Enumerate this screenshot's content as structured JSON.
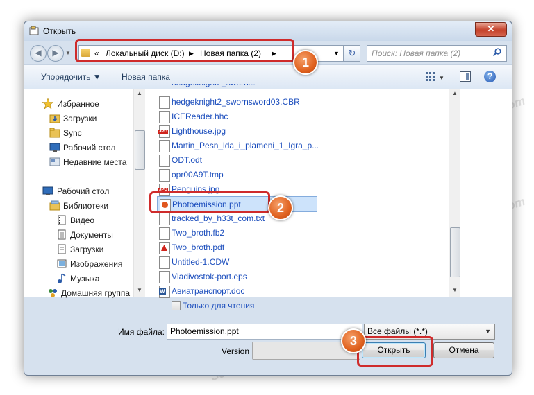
{
  "window": {
    "title": "Открыть",
    "close_label": "✕"
  },
  "navigation": {
    "back_label": "◀",
    "forward_label": "▶",
    "address_prefix": "«",
    "address_segments": [
      "Локальный диск (D:)",
      "Новая папка (2)"
    ],
    "address_dropdown": "▼",
    "refresh_label": "↻",
    "search_placeholder": "Поиск: Новая папка (2)"
  },
  "toolbar": {
    "organize_label": "Упорядочить ▼",
    "new_folder_label": "Новая папка",
    "views_icon": "views-icon",
    "preview_icon": "preview-pane-icon",
    "help_label": "?"
  },
  "nav_pane": {
    "items": [
      {
        "label": "Избранное",
        "icon": "star-icon"
      },
      {
        "label": "Загрузки",
        "icon": "downloads-folder-icon"
      },
      {
        "label": "Sync",
        "icon": "folder-icon"
      },
      {
        "label": "Рабочий стол",
        "icon": "desktop-icon"
      },
      {
        "label": "Недавние места",
        "icon": "recent-places-icon"
      },
      {
        "label": "Рабочий стол",
        "icon": "desktop-icon"
      },
      {
        "label": "Библиотеки",
        "icon": "libraries-icon"
      },
      {
        "label": "Видео",
        "icon": "video-icon"
      },
      {
        "label": "Документы",
        "icon": "documents-icon"
      },
      {
        "label": "Загрузки",
        "icon": "downloads-icon"
      },
      {
        "label": "Изображения",
        "icon": "pictures-icon"
      },
      {
        "label": "Музыка",
        "icon": "music-icon"
      },
      {
        "label": "Домашняя группа",
        "icon": "homegroup-icon"
      }
    ]
  },
  "files": [
    {
      "name": "hedgeknight2_swornsword03.CBR",
      "icon": "document-icon"
    },
    {
      "name": "ICEReader.hhc",
      "icon": "document-icon"
    },
    {
      "name": "Lighthouse.jpg",
      "icon": "jpg-icon"
    },
    {
      "name": "Martin_Pesn_lda_i_plameni_1_Igra_p...",
      "icon": "document-icon"
    },
    {
      "name": "ODT.odt",
      "icon": "document-icon"
    },
    {
      "name": "opr00A9T.tmp",
      "icon": "document-icon"
    },
    {
      "name": "Penguins.jpg",
      "icon": "jpg-icon"
    },
    {
      "name": "Photoemission.ppt",
      "icon": "ppt-icon",
      "selected": true
    },
    {
      "name": "tracked_by_h33t_com.txt",
      "icon": "document-icon"
    },
    {
      "name": "Two_broth.fb2",
      "icon": "document-icon"
    },
    {
      "name": "Two_broth.pdf",
      "icon": "pdf-icon"
    },
    {
      "name": "Untitled-1.CDW",
      "icon": "document-icon"
    },
    {
      "name": "Vladivostok-port.eps",
      "icon": "document-icon"
    },
    {
      "name": "Авиатранспорт.doc",
      "icon": "word-icon"
    }
  ],
  "readonly_label": "Только для чтения",
  "bottom": {
    "filename_label": "Имя файла:",
    "filename_value": "Photoemission.ppt",
    "filetype_value": "Все файлы (*.*)",
    "version_label": "Version",
    "open_label": "Открыть",
    "cancel_label": "Отмена"
  },
  "callouts": [
    "1",
    "2",
    "3"
  ],
  "watermark": "Soringpcrepair.com",
  "colors": {
    "accent": "#cf2b2b",
    "callout": "#e0621f",
    "link": "#1c4ebd"
  }
}
